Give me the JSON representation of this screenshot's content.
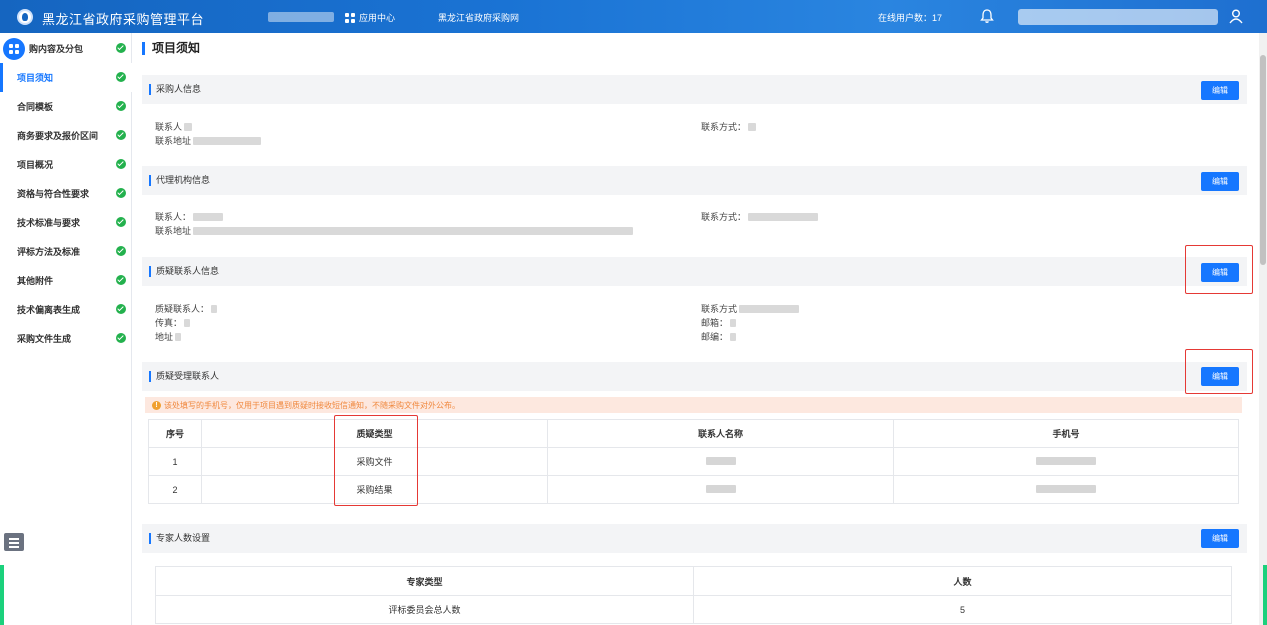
{
  "header": {
    "app_title": "黑龙江省政府采购管理平台",
    "app_center": "应用中心",
    "site_link": "黑龙江省政府采购网",
    "online_users": "在线用户数：17"
  },
  "sidebar": {
    "items": [
      {
        "label": "购内容及分包"
      },
      {
        "label": "项目须知"
      },
      {
        "label": "合同模板"
      },
      {
        "label": "商务要求及报价区间"
      },
      {
        "label": "项目概况"
      },
      {
        "label": "资格与符合性要求"
      },
      {
        "label": "技术标准与要求"
      },
      {
        "label": "评标方法及标准"
      },
      {
        "label": "其他附件"
      },
      {
        "label": "技术偏离表生成"
      },
      {
        "label": "采购文件生成"
      }
    ]
  },
  "main": {
    "page_title": "项目须知",
    "edit_label": "编辑",
    "purchaser": {
      "title": "采购人信息",
      "contact_label": "联系人",
      "address_label": "联系地址",
      "phone_label": "联系方式："
    },
    "agency": {
      "title": "代理机构信息",
      "contact_label": "联系人：",
      "address_label": "联系地址",
      "phone_label": "联系方式："
    },
    "inquiry": {
      "title": "质疑联系人信息",
      "contact_label": "质疑联系人：",
      "fax_label": "传真：",
      "address_label": "地址",
      "phone_label": "联系方式",
      "email_label": "邮箱：",
      "postcode_label": "邮编："
    },
    "handler": {
      "title": "质疑受理联系人",
      "notice": "该处填写的手机号，仅用于项目遇到质疑时接收短信通知，不随采购文件对外公布。",
      "columns": [
        "序号",
        "质疑类型",
        "联系人名称",
        "手机号"
      ],
      "rows": [
        {
          "no": "1",
          "type": "采购文件"
        },
        {
          "no": "2",
          "type": "采购结果"
        }
      ]
    },
    "experts": {
      "title": "专家人数设置",
      "columns": [
        "专家类型",
        "人数"
      ],
      "rows": [
        {
          "type": "评标委员会总人数",
          "count": "5"
        }
      ]
    }
  },
  "colors": {
    "primary": "#1677ff",
    "success": "#23b14d",
    "highlight": "#e53935",
    "notice_bg": "#fde8df"
  }
}
